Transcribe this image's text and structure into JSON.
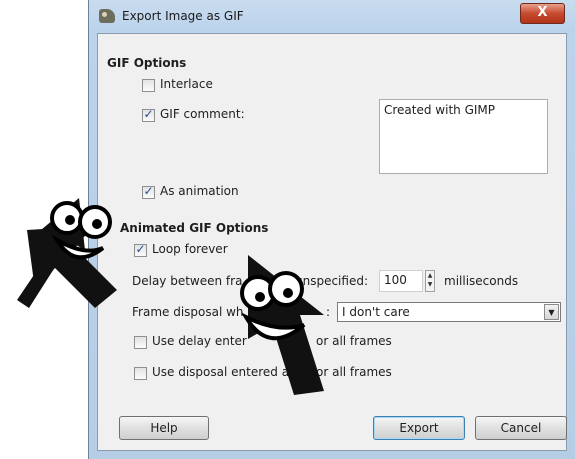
{
  "window": {
    "title": "Export Image as GIF",
    "close_label": "X"
  },
  "gif_options": {
    "heading": "GIF Options",
    "interlace_label": "Interlace",
    "interlace_checked": false,
    "gif_comment_label": "GIF comment:",
    "gif_comment_checked": true,
    "gif_comment_value": "Created with GIMP",
    "as_animation_label": "As animation",
    "as_animation_checked": true
  },
  "animated_gif_options": {
    "heading": "Animated GIF Options",
    "loop_forever_label": "Loop forever",
    "loop_forever_checked": true,
    "delay_label_left": "Delay between fra",
    "delay_label_right": "unspecified:",
    "delay_value": "100",
    "delay_unit": "milliseconds",
    "disposal_label_left": "Frame disposal wh",
    "disposal_label_right": ":",
    "disposal_value": "I don't care",
    "use_delay_label_left": "Use delay enter",
    "use_delay_label_right": "or all frames",
    "use_delay_checked": false,
    "use_disposal_label_left": "Use disposal entered a",
    "use_disposal_label_right": "or all frames",
    "use_disposal_checked": false
  },
  "buttons": {
    "help": "Help",
    "export": "Export",
    "cancel": "Cancel"
  },
  "icons": {
    "app": "gimp-icon",
    "mascot": "googly-eyed-arrow-icon"
  }
}
